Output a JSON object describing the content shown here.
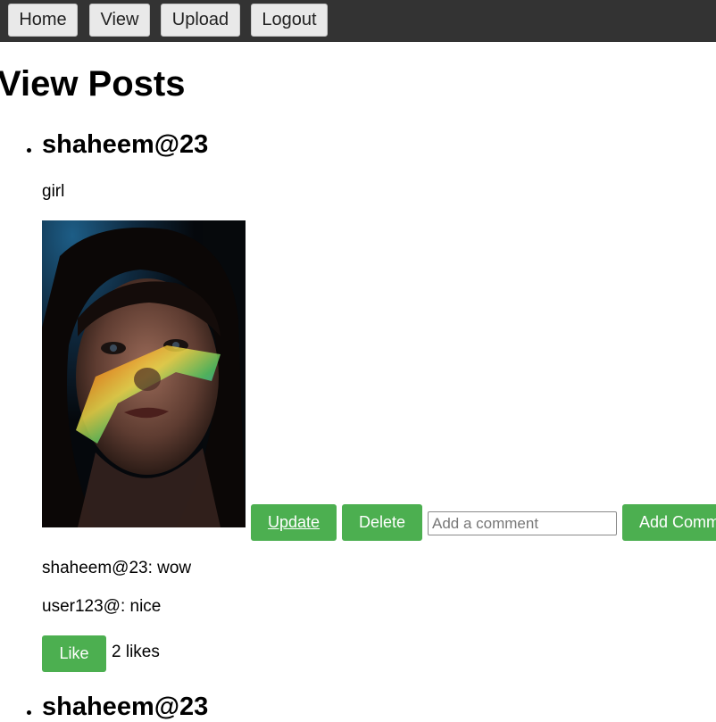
{
  "nav": {
    "home_label": "Home",
    "view_label": "View",
    "upload_label": "Upload",
    "logout_label": "Logout"
  },
  "page": {
    "title": "View Posts"
  },
  "posts": [
    {
      "author": "shaheem@23",
      "caption": "girl",
      "image_icon": "portrait-photo",
      "update_label": "Update",
      "delete_label": "Delete",
      "comment_placeholder": "Add a comment",
      "comment_value": "",
      "add_comment_label": "Add Comment",
      "comments": [
        {
          "text": "shaheem@23: wow"
        },
        {
          "text": "user123@: nice"
        }
      ],
      "like_label": "Like",
      "likes_text": "2 likes"
    },
    {
      "author": "shaheem@23"
    }
  ],
  "colors": {
    "navbar": "#333333",
    "accent_green": "#4caf50",
    "nav_button": "#e9e9e9"
  }
}
